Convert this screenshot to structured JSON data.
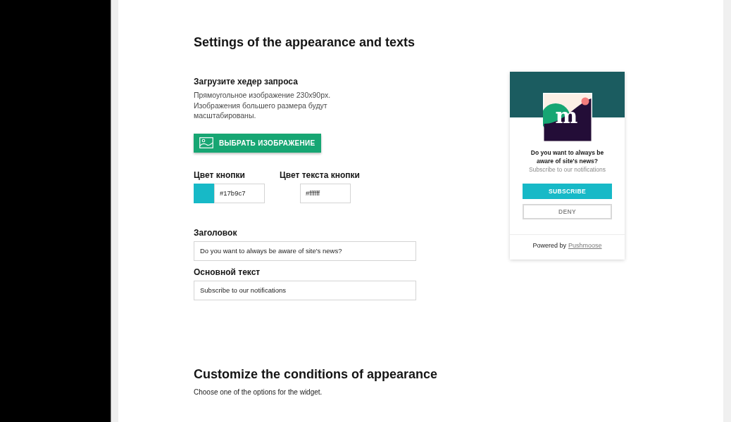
{
  "settings": {
    "heading": "Settings of the appearance and texts"
  },
  "upload": {
    "label": "Загрузите хедер запроса",
    "description": "Прямоугольное изображение 230x90px. Изображения большего размера будут масштабированы.",
    "button": "ВЫБРАТЬ ИЗОБРАЖЕНИЕ"
  },
  "color_fields": [
    {
      "label": "Цвет кнопки",
      "value": "#17b9c7",
      "color": "#17b9c7"
    },
    {
      "label": "Цвет текста кнопки",
      "value": "#ffffff"
    }
  ],
  "text_fields": [
    {
      "label": "Заголовок",
      "value": "Do you want to always be aware of site's news?"
    },
    {
      "label": "Основной текст",
      "value": "Subscribe to our notifications"
    }
  ],
  "preview": {
    "logo_letter": "m",
    "title": "Do you want to always be aware of site's news?",
    "subtitle": "Subscribe to our notifications",
    "subscribe_button": "SUBSCRIBE",
    "deny_button": "DENY",
    "powered_by": "Powered by",
    "brand_link": "Pushmoose"
  },
  "conditions": {
    "heading": "Customize the conditions of appearance",
    "description": "Choose one of the options for the widget."
  }
}
